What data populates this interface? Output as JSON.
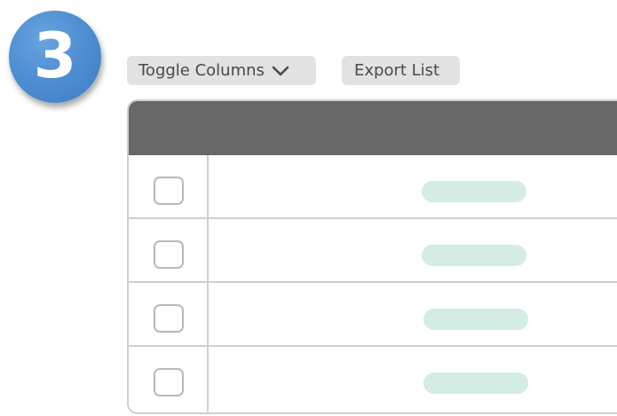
{
  "step_badge": {
    "number": "3",
    "color": "#4f8fd3"
  },
  "toolbar": {
    "toggle_columns_label": "Toggle Columns",
    "toggle_columns_icon": "chevron-down-icon",
    "export_list_label": "Export List"
  },
  "table": {
    "header_color": "#676867",
    "rows": [
      {
        "checked": false,
        "placeholder_color": "#d3ece4"
      },
      {
        "checked": false,
        "placeholder_color": "#d3ece4"
      },
      {
        "checked": false,
        "placeholder_color": "#d3ece4"
      },
      {
        "checked": false,
        "placeholder_color": "#d3ece4"
      }
    ]
  }
}
